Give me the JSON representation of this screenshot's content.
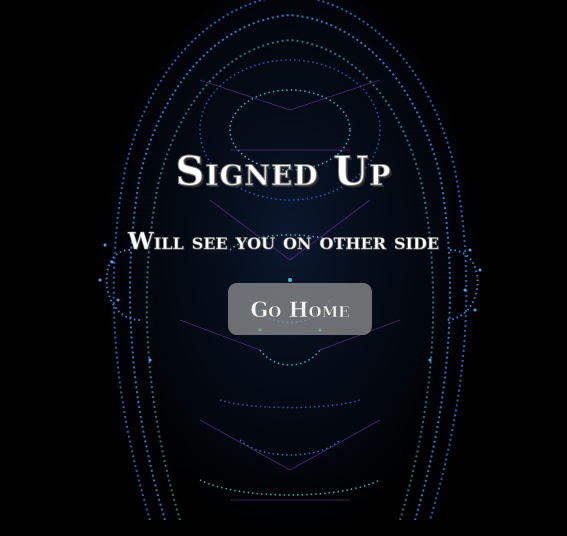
{
  "title": "Signed Up",
  "subtitle": "Will see you on other side",
  "home_button": {
    "label": "Go Home"
  },
  "background": {
    "image": "digital-face-icon",
    "colors": {
      "base": "#000000",
      "blue": "#1f6fd1",
      "cyan": "#33d6e0",
      "purple": "#7a2fa0"
    }
  }
}
